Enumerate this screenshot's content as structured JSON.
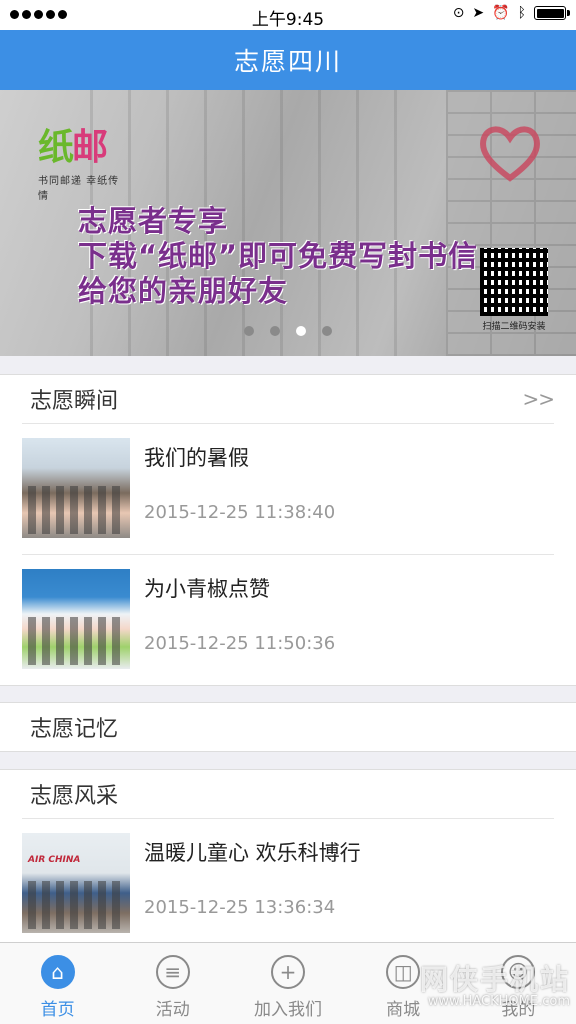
{
  "status_bar": {
    "time": "上午9:45"
  },
  "navbar": {
    "title": "志愿四川"
  },
  "banner": {
    "logo_text": "纸邮",
    "logo_text_first": "纸",
    "logo_text_second": "邮",
    "logo_subtitle": "书同邮递 幸纸传情",
    "line1": "志愿者专享",
    "line2": "下载“纸邮”即可免费写封书信",
    "line3": "给您的亲朋好友",
    "qr_caption": "扫描二维码安装",
    "dots_total": 4,
    "dots_active": 3
  },
  "sections": [
    {
      "title": "志愿瞬间",
      "more_label": ">>",
      "items": [
        {
          "title": "我们的暑假",
          "time": "2015-12-25 11:38:40"
        },
        {
          "title": "为小青椒点赞",
          "time": "2015-12-25 11:50:36"
        }
      ]
    },
    {
      "title": "志愿记忆"
    },
    {
      "title": "志愿风采",
      "items": [
        {
          "title": "温暖儿童心 欢乐科博行",
          "time": "2015-12-25 13:36:34"
        }
      ]
    }
  ],
  "tabbar": [
    {
      "label": "首页",
      "icon": "home-icon",
      "active": true
    },
    {
      "label": "活动",
      "icon": "list-icon"
    },
    {
      "label": "加入我们",
      "icon": "plus-icon"
    },
    {
      "label": "商城",
      "icon": "bag-icon"
    },
    {
      "label": "我的",
      "icon": "user-icon"
    }
  ],
  "watermark": {
    "text": "网侠手机站",
    "url": "www.HACKHOME.com"
  },
  "colors": {
    "accent": "#3c8fe5",
    "banner_text": "#7a2f8c",
    "logo_green": "#6ab82c",
    "logo_pink": "#d83b7a"
  }
}
